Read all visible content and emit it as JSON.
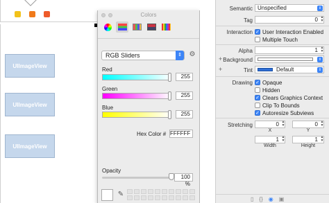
{
  "colors_window": {
    "title": "Colors",
    "modes": [
      "color-wheel",
      "color-sliders",
      "color-palettes",
      "image-palettes",
      "pencils"
    ],
    "picker": "RGB Sliders",
    "sliders": [
      {
        "label": "Red",
        "value": "255"
      },
      {
        "label": "Green",
        "value": "255"
      },
      {
        "label": "Blue",
        "value": "255"
      }
    ],
    "hex_label": "Hex Color #",
    "hex_value": "FFFFFF",
    "opacity_label": "Opacity",
    "opacity_value": "100 %"
  },
  "canvas": {
    "image_views": [
      "UIImageView",
      "UIImageView",
      "UIImageView"
    ]
  },
  "inspector": {
    "semantic_label": "Semantic",
    "semantic_value": "Unspecified",
    "tag_label": "Tag",
    "tag_value": "0",
    "interaction_label": "Interaction",
    "interaction_options": [
      {
        "label": "User Interaction Enabled",
        "checked": true
      },
      {
        "label": "Multiple Touch",
        "checked": false
      }
    ],
    "alpha_label": "Alpha",
    "alpha_value": "1",
    "background_label": "Background",
    "tint_label": "Tint",
    "tint_value": "Default",
    "drawing_label": "Drawing",
    "drawing_options": [
      {
        "label": "Opaque",
        "checked": true
      },
      {
        "label": "Hidden",
        "checked": false
      },
      {
        "label": "Clears Graphics Context",
        "checked": true
      },
      {
        "label": "Clip To Bounds",
        "checked": false
      },
      {
        "label": "Autoresize Subviews",
        "checked": true
      }
    ],
    "stretching_label": "Stretching",
    "stretch_x_value": "0",
    "stretch_y_value": "0",
    "stretch_x_label": "X",
    "stretch_y_label": "Y",
    "stretch_w_value": "1",
    "stretch_h_value": "1",
    "stretch_w_label": "Width",
    "stretch_h_label": "Height",
    "accent_color": "#3d85f7"
  }
}
